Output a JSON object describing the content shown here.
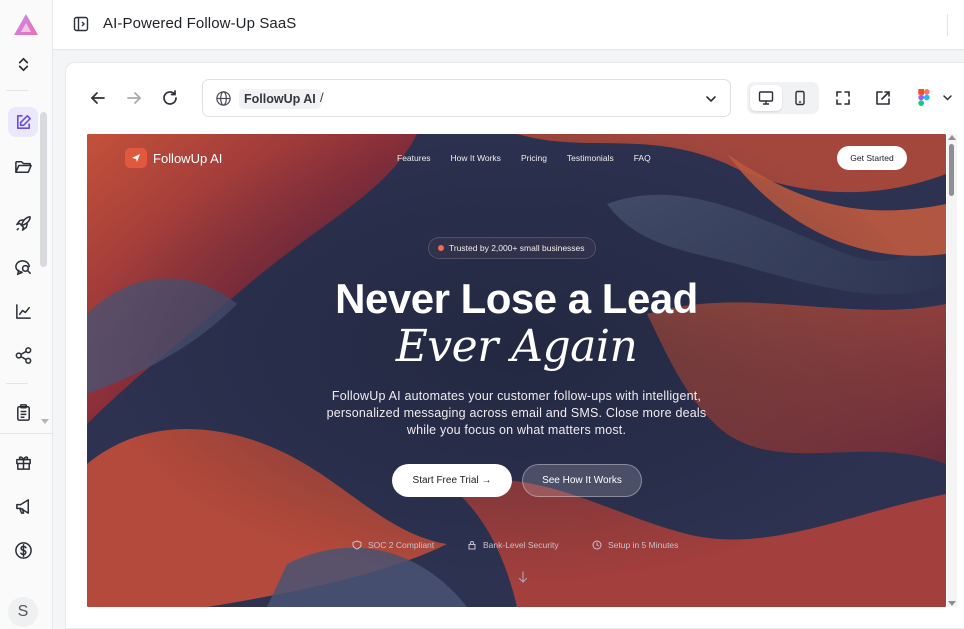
{
  "window": {
    "title": "AI-Powered Follow-Up SaaS"
  },
  "rail": {
    "items": [
      {
        "icon": "edit-icon",
        "active": true
      },
      {
        "icon": "folder-icon"
      },
      {
        "icon": "rocket-icon"
      },
      {
        "icon": "search-chat-icon"
      },
      {
        "icon": "chart-line-icon"
      },
      {
        "icon": "share-icon"
      },
      {
        "icon": "clipboard-icon"
      },
      {
        "icon": "gift-icon"
      },
      {
        "icon": "megaphone-icon"
      },
      {
        "icon": "dollar-icon"
      }
    ],
    "avatar_initial": "S"
  },
  "browser": {
    "url_chip": "FollowUp AI",
    "url_path": "/",
    "device_selected": "desktop"
  },
  "site": {
    "brand": "FollowUp AI",
    "nav": [
      "Features",
      "How It Works",
      "Pricing",
      "Testimonials",
      "FAQ"
    ],
    "nav_cta": "Get Started",
    "badge": "Trusted by 2,000+ small businesses",
    "headline_1": "Never Lose a Lead",
    "headline_2": "Ever Again",
    "subtitle": "FollowUp AI automates your customer follow-ups with intelligent, personalized messaging across email and SMS. Close more deals while you focus on what matters most.",
    "primary_cta": "Start Free Trial →",
    "secondary_cta": "See How It Works",
    "trust_items": [
      "SOC 2 Compliant",
      "Bank-Level Security",
      "Setup in 5 Minutes"
    ]
  },
  "colors": {
    "accent": "#6a4de0",
    "brand_orange": "#e0593c",
    "hero_navy": "#2a2f4a"
  }
}
